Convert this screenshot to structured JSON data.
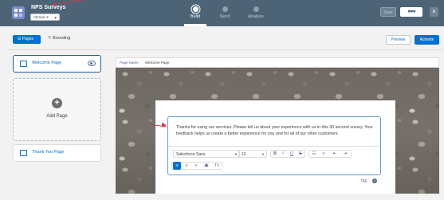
{
  "header": {
    "app_title": "NPS Surveys",
    "version": "Version 4",
    "steps": [
      {
        "label": "Build",
        "active": true
      },
      {
        "label": "Send",
        "active": false
      },
      {
        "label": "Analyze",
        "active": false
      }
    ],
    "save_label": "Save",
    "more_label": "●●●",
    "close_label": "×"
  },
  "toolbar": {
    "pages_tab": "Pages",
    "branding_tab": "Branding",
    "preview_label": "Preview",
    "activate_label": "Activate"
  },
  "sidebar": {
    "pages": [
      {
        "label": "Welcome Page",
        "selected": true
      },
      {
        "label": "Thank You Page",
        "selected": false
      }
    ],
    "add_page_label": "Add Page"
  },
  "canvas": {
    "page_name_label": "Page Name",
    "page_name_value": "Welcome Page",
    "editor_text": "Thanks for using our services. Please tell us about your experience with us in this 30 second survey. Your feedback helps us create a better experience for you and for all of our other customers.",
    "font_family": "Salesforce Sans",
    "font_size": "12",
    "char_count": "766",
    "accent_color": "#0070d2"
  }
}
